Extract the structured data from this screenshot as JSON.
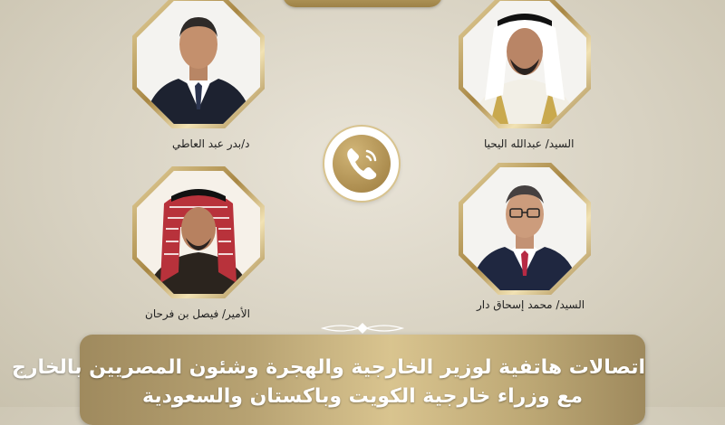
{
  "people": [
    {
      "id": "top-left",
      "caption": "د/بدر عبد العاطي"
    },
    {
      "id": "top-right",
      "caption": "السيد/ عبدالله اليحيا"
    },
    {
      "id": "bottom-left",
      "caption": "الأمير/ فيصل بن فرحان"
    },
    {
      "id": "bottom-right",
      "caption": "السيد/ محمد إسحاق دار"
    }
  ],
  "center_icon": "phone-call-icon",
  "headline": {
    "line1": "اتصالات هاتفية لوزير الخارجية والهجرة وشئون المصريين بالخارج",
    "line2": "مع وزراء خارجية الكويت وباكستان والسعودية"
  },
  "colors": {
    "gold": "#b09455",
    "background": "#ddd7c8",
    "banner_text": "#ffffff"
  }
}
